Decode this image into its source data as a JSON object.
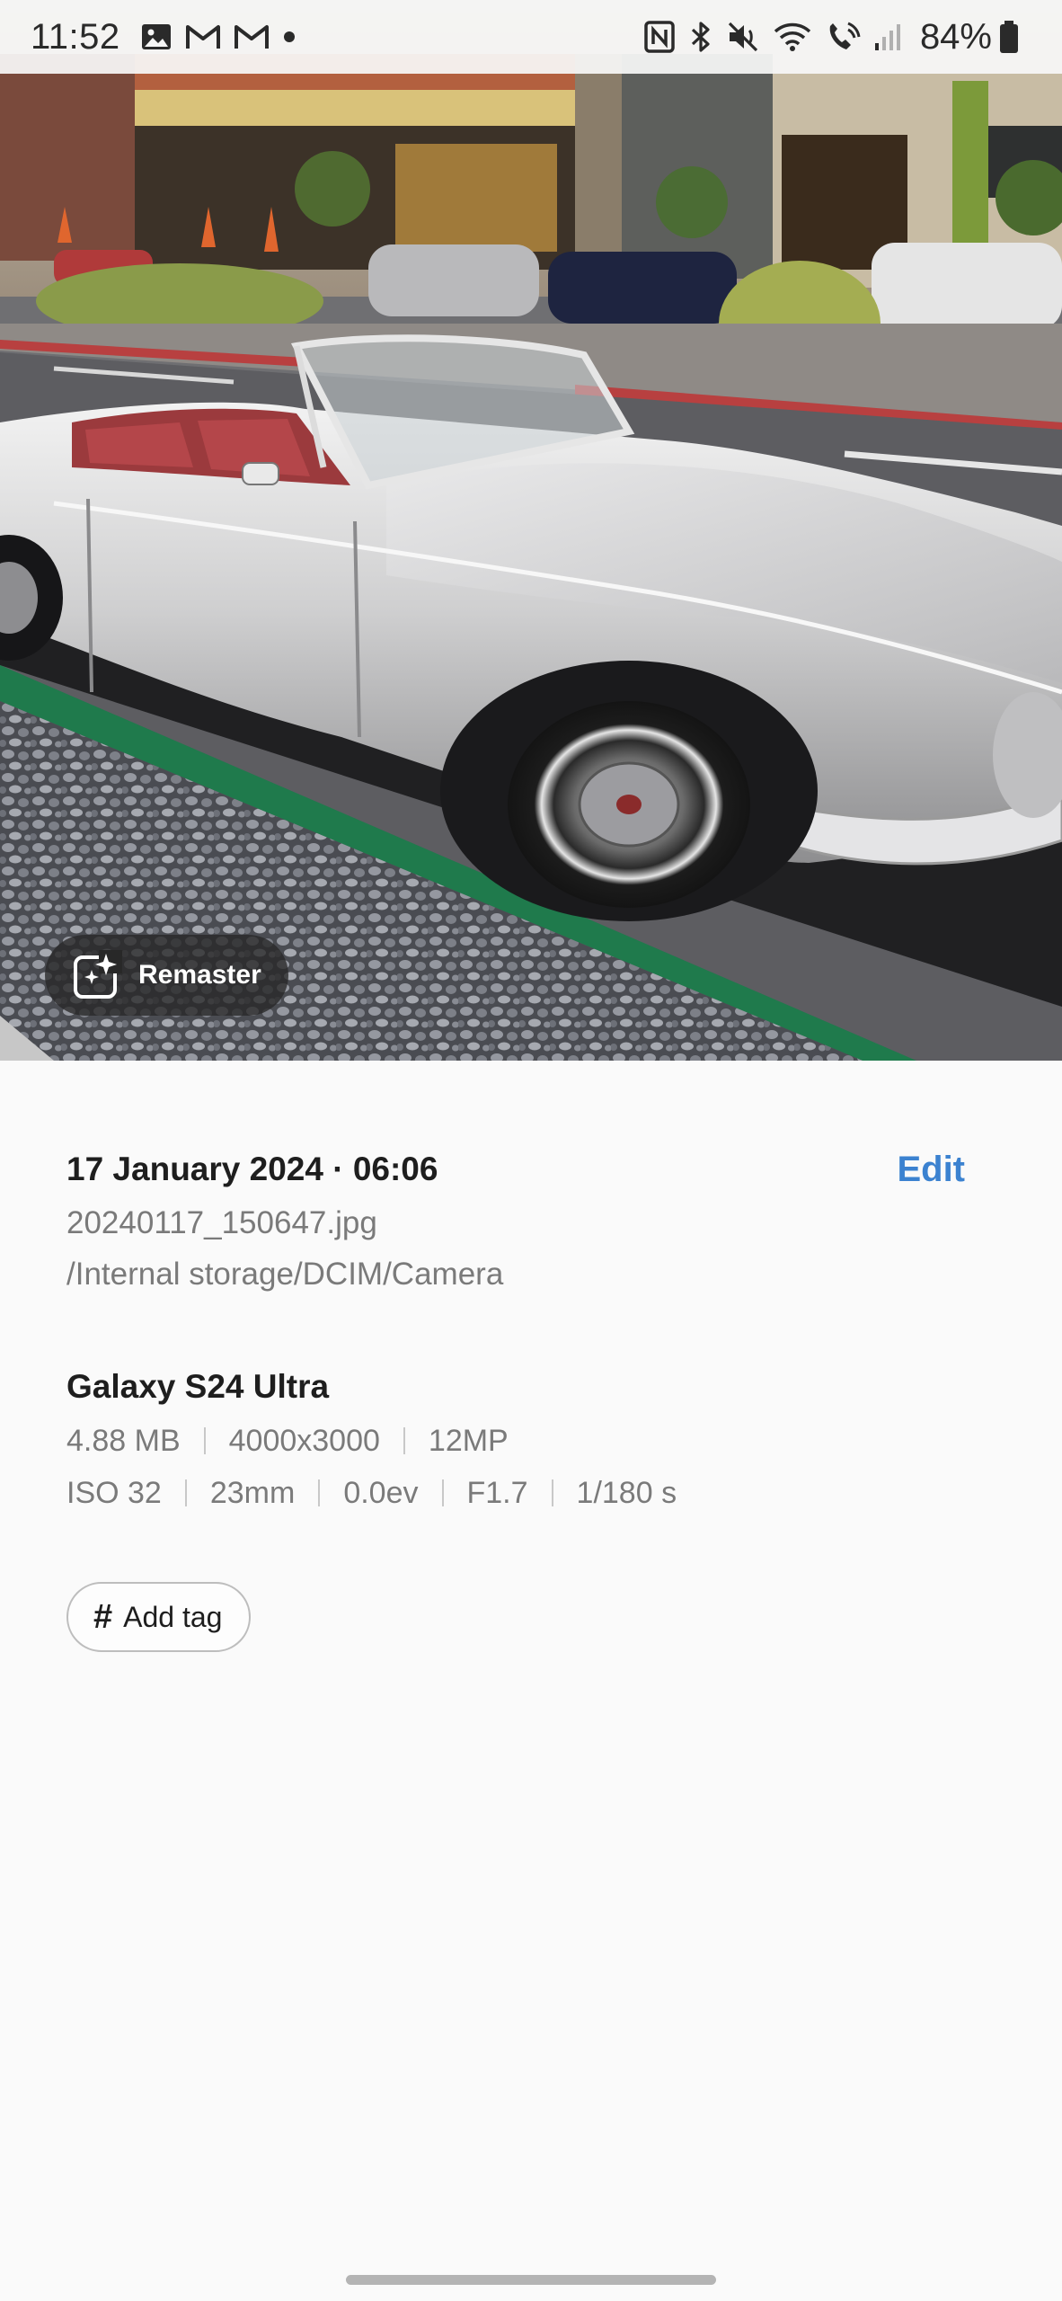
{
  "status_bar": {
    "time": "11:52",
    "battery": "84%",
    "left_icons": [
      "gallery-notification-icon",
      "gmail-icon",
      "gmail-icon",
      "more-notifications-dot-icon"
    ],
    "right_icons": [
      "nfc-icon",
      "bluetooth-icon",
      "mute-icon",
      "wifi-icon",
      "wifi-calling-icon",
      "signal-icon",
      "battery-icon"
    ]
  },
  "photo": {
    "remaster_label": "Remaster"
  },
  "details": {
    "date_time": "17 January 2024 · 06:06",
    "edit_label": "Edit",
    "filename": "20240117_150647.jpg",
    "path": "/Internal storage/DCIM/Camera",
    "device": "Galaxy S24 Ultra",
    "file_specs": [
      "4.88 MB",
      "4000x3000",
      "12MP"
    ],
    "camera_specs": [
      "ISO 32",
      "23mm",
      "0.0ev",
      "F1.7",
      "1/180 s"
    ],
    "add_tag_label": "Add tag"
  },
  "colors": {
    "accent": "#3b82d0",
    "background": "#fafafa",
    "primary_text": "#1e1e1e",
    "secondary_text": "#7a7a7a"
  }
}
